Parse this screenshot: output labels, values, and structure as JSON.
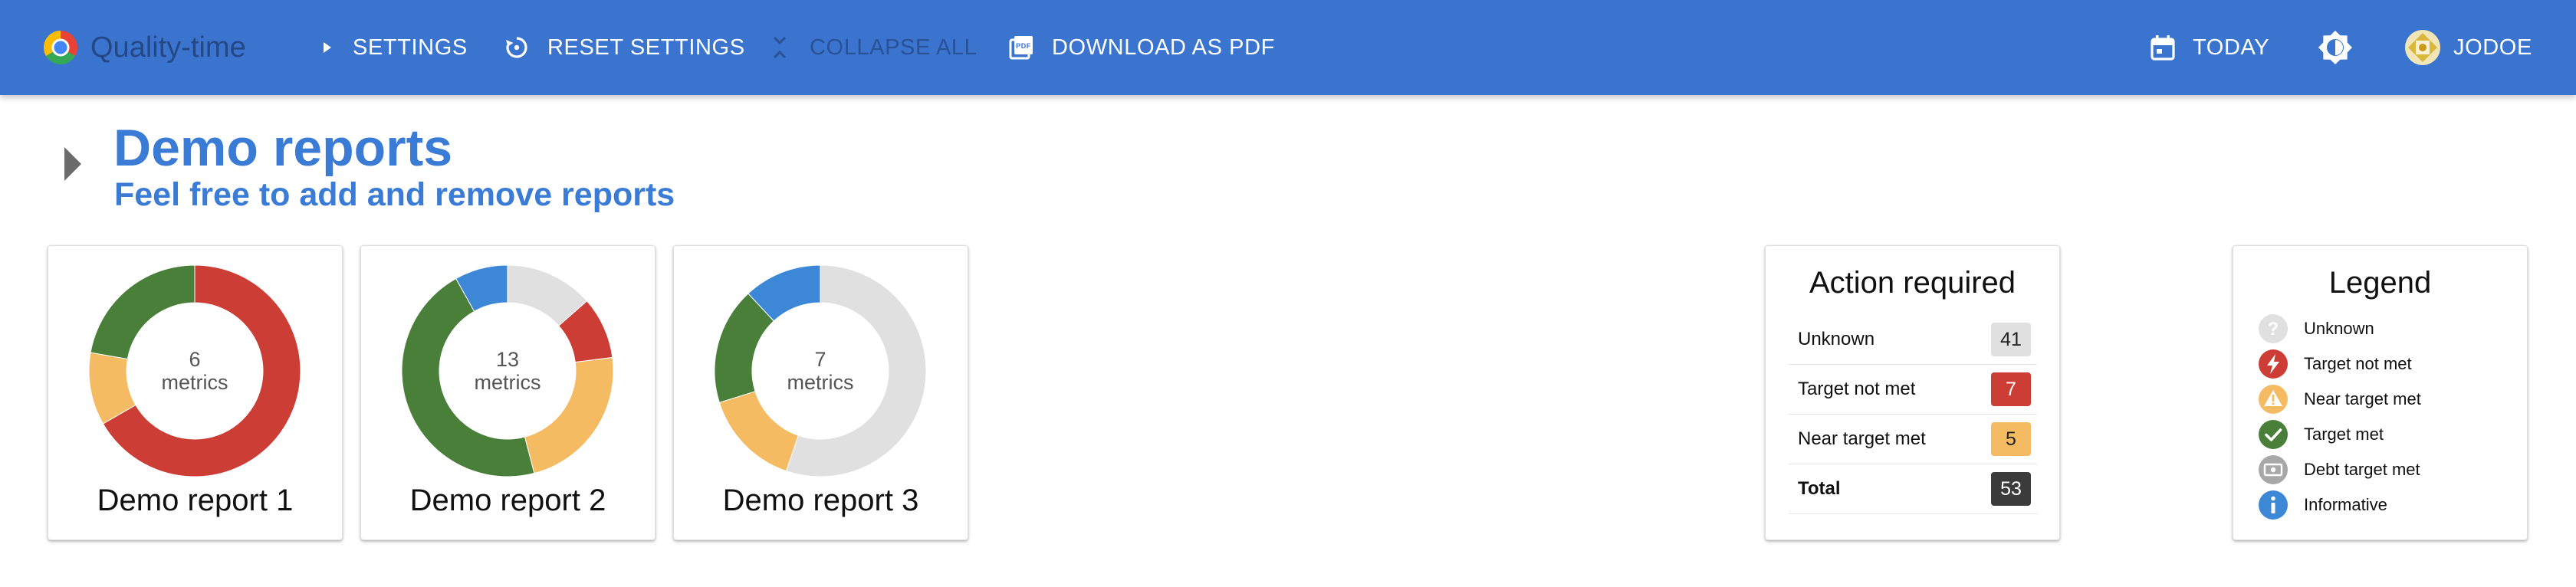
{
  "appbar": {
    "brand": "Quality-time",
    "settings": "SETTINGS",
    "reset": "RESET SETTINGS",
    "collapse": "COLLAPSE ALL",
    "download": "DOWNLOAD AS PDF",
    "date": "TODAY",
    "user": "JODOE",
    "icons": {
      "settings": "caret-right-icon",
      "reset": "reset-icon",
      "collapse": "collapse-icon",
      "download": "pdf-icon",
      "date": "calendar-icon",
      "theme": "brightness-icon",
      "user": "avatar"
    }
  },
  "header": {
    "title": "Demo reports",
    "subtitle": "Feel free to add and remove reports"
  },
  "reports": [
    {
      "title": "Demo report 1",
      "count": "6",
      "unit": "metrics",
      "segments": [
        {
          "status": "target_not_met",
          "fraction": 0.6667
        },
        {
          "status": "near_target_met",
          "fraction": 0.1111
        },
        {
          "status": "target_met",
          "fraction": 0.2222
        }
      ]
    },
    {
      "title": "Demo report 2",
      "count": "13",
      "unit": "metrics",
      "segments": [
        {
          "status": "unknown",
          "fraction": 0.1351
        },
        {
          "status": "target_not_met",
          "fraction": 0.0946
        },
        {
          "status": "near_target_met",
          "fraction": 0.2297
        },
        {
          "status": "target_met",
          "fraction": 0.4595
        },
        {
          "status": "informative",
          "fraction": 0.0811
        }
      ]
    },
    {
      "title": "Demo report 3",
      "count": "7",
      "unit": "metrics",
      "segments": [
        {
          "status": "unknown",
          "fraction": 0.5522
        },
        {
          "status": "near_target_met",
          "fraction": 0.1493
        },
        {
          "status": "target_met",
          "fraction": 0.1791
        },
        {
          "status": "informative",
          "fraction": 0.1194
        }
      ]
    }
  ],
  "action_required": {
    "title": "Action required",
    "rows": [
      {
        "label": "Unknown",
        "count": "41",
        "status": "unknown"
      },
      {
        "label": "Target not met",
        "count": "7",
        "status": "target_not_met"
      },
      {
        "label": "Near target met",
        "count": "5",
        "status": "near_target_met"
      },
      {
        "label": "Total",
        "count": "53",
        "status": "total"
      }
    ]
  },
  "legend": {
    "title": "Legend",
    "items": [
      {
        "label": "Unknown",
        "status": "unknown",
        "icon": "question-icon"
      },
      {
        "label": "Target not met",
        "status": "target_not_met",
        "icon": "lightning-icon"
      },
      {
        "label": "Near target met",
        "status": "near_target_met",
        "icon": "warning-icon"
      },
      {
        "label": "Target met",
        "status": "target_met",
        "icon": "check-icon"
      },
      {
        "label": "Debt target met",
        "status": "debt_target_met",
        "icon": "money-icon"
      },
      {
        "label": "Informative",
        "status": "informative",
        "icon": "info-icon"
      }
    ]
  },
  "colors": {
    "appbar": "#3a74cf",
    "title": "#3a7bd5",
    "unknown": "#e0e0e0",
    "target_not_met": "#cc3e35",
    "near_target_met": "#f5bb63",
    "target_met": "#4a7f3a",
    "debt_target_met": "#a8a8a8",
    "informative": "#3d88d6",
    "total": "#3b3b3b"
  }
}
